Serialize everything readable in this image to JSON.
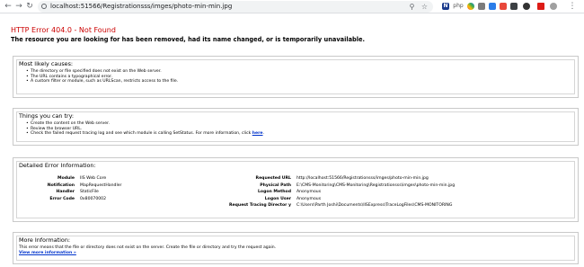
{
  "browser": {
    "url": "localhost:51566/Registrationsss/imges/photo-min-min.jpg",
    "extension_labels": [
      "php",
      "N"
    ]
  },
  "error": {
    "title": "HTTP Error 404.0 - Not Found",
    "description": "The resource you are looking for has been removed, had its name changed, or is temporarily unavailable."
  },
  "causes": {
    "heading": "Most likely causes:",
    "items": [
      "The directory or file specified does not exist on the Web server.",
      "The URL contains a typographical error.",
      "A custom filter or module, such as URLScan, restricts access to the file."
    ]
  },
  "try": {
    "heading": "Things you can try:",
    "items": [
      "Create the content on the Web server.",
      "Review the browser URL."
    ],
    "last_item_prefix": "Check the failed request tracing log and see which module is calling SetStatus. For more information, click ",
    "last_item_link": "here",
    "last_item_suffix": "."
  },
  "details": {
    "heading": "Detailed Error Information:",
    "left": [
      {
        "key": "Module",
        "value": "IIS Web Core"
      },
      {
        "key": "Notification",
        "value": "MapRequestHandler"
      },
      {
        "key": "Handler",
        "value": "StaticFile"
      },
      {
        "key": "Error Code",
        "value": "0x80070002"
      }
    ],
    "right": [
      {
        "key": "Requested URL",
        "value": "http://localhost:51566/Registrationsss/imges/photo-min-min.jpg"
      },
      {
        "key": "Physical Path",
        "value": "E:\\CMS-Monitoring\\CMS-Monitoring\\Registrationsss\\imges\\photo-min-min.jpg"
      },
      {
        "key": "Logon Method",
        "value": "Anonymous"
      },
      {
        "key": "Logon User",
        "value": "Anonymous"
      },
      {
        "key": "Request Tracing Director y",
        "value": "C:\\Users\\Parth Joshi\\Documents\\IISExpress\\TraceLogFiles\\CMS-MONITORING"
      }
    ]
  },
  "more": {
    "heading": "More Information:",
    "text": "This error means that the file or directory does not exist on the server. Create the file or directory and try the request again.",
    "link": "View more information »"
  }
}
